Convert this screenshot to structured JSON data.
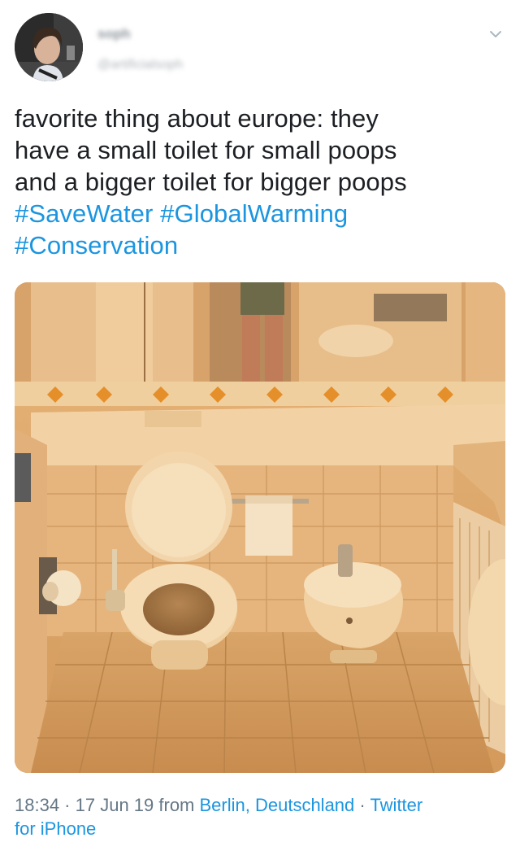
{
  "author": {
    "name": "soph",
    "handle": "@artificialsoph"
  },
  "tweet": {
    "line1": "favorite thing about europe: they",
    "line2": "have a small toilet for small poops",
    "line3": "and a bigger toilet for bigger poops",
    "hashtags": [
      "#SaveWater",
      "#GlobalWarming",
      "#Conservation"
    ]
  },
  "footer": {
    "time": "18:34",
    "sep1": " · ",
    "date": "17 Jun 19",
    "from": " from ",
    "location": "Berlin, Deutschland",
    "sep2": " · ",
    "client_a": "Twitter",
    "client_b": "for iPhone"
  },
  "icons": {
    "menu": "chevron-down-icon"
  },
  "colors": {
    "link": "#1b95e0",
    "meta": "#657786",
    "text": "#1c1f23"
  }
}
